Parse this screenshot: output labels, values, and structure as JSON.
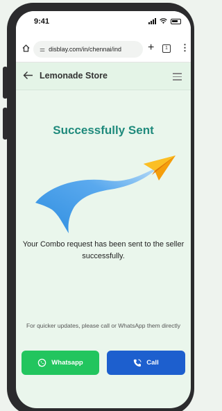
{
  "status_bar": {
    "time": "9:41",
    "icons": [
      "signal-icon",
      "wifi-icon",
      "battery-icon"
    ]
  },
  "browser": {
    "url": "disblay.com/in/chennai/ind",
    "tab_count": "1",
    "icons": [
      "home-icon",
      "tune-icon",
      "plus-icon",
      "tabs-icon",
      "more-vert-icon"
    ]
  },
  "app_bar": {
    "title": "Lemonade Store",
    "icons": [
      "back-arrow-icon",
      "hamburger-menu-icon"
    ]
  },
  "main": {
    "heading": "Successfully Sent",
    "message": "Your Combo request has been sent to the seller successfully.",
    "hint": "For quicker updates, please call or WhatsApp them directly"
  },
  "actions": {
    "whatsapp_label": "Whatsapp",
    "call_label": "Call"
  },
  "colors": {
    "heading": "#1f8a7c",
    "whatsapp_button": "#22c55e",
    "call_button": "#1d5fce",
    "background": "#eaf6ec",
    "paper_plane": "#f59e0b"
  }
}
